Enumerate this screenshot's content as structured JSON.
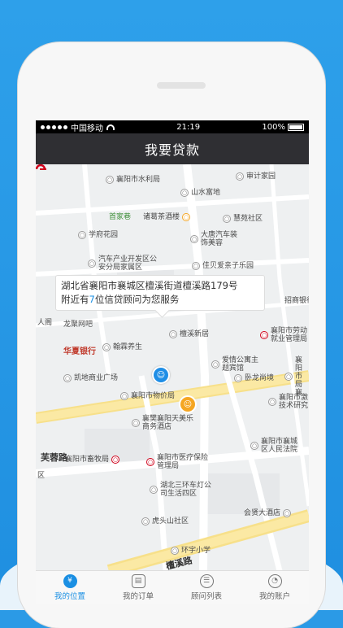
{
  "status_bar": {
    "carrier": "中国移动",
    "time": "21:19",
    "battery": "100%"
  },
  "header": {
    "title": "我要贷款"
  },
  "map": {
    "callout": {
      "line1": "湖北省襄阳市襄城区檀溪街道檀溪路179号",
      "line2_prefix": "附近有",
      "advisor_count": "7",
      "line2_suffix": "位信贷顾问为您服务"
    },
    "pois": [
      "襄阳市水利局",
      "审计家园",
      "山水富地",
      "首家巷",
      "诸葛茶酒楼",
      "慧苑社区",
      "学府花园",
      "大唐汽车装饰美容",
      "汽车产业开发区公安分局家属区",
      "佳贝爱亲子乐园",
      "招商银行",
      "人阁",
      "龙聚网吧",
      "檀溪新居",
      "襄阳市劳动就业管理局",
      "华夏银行",
      "翰霖养生",
      "爱情公寓主题宾馆",
      "襄阳市局襄",
      "凯地商业广场",
      "卧龙尚境",
      "襄阳市物价局",
      "襄阳市激技术研究",
      "襄樊襄阳天美乐商务酒店",
      "襄阳市襄城区人民法院",
      "芙蓉路",
      "区",
      "襄阳市畜牧局",
      "襄阳市医疗保险管理局",
      "湖北三环车灯公司生活四区",
      "会贤大酒店",
      "虎头山社区",
      "环宇小学",
      "檀溪路"
    ]
  },
  "tabbar": {
    "tabs": [
      {
        "label": "我的位置",
        "icon": "yen-icon",
        "glyph": "¥"
      },
      {
        "label": "我的订单",
        "icon": "order-icon",
        "glyph": "▤"
      },
      {
        "label": "顾问列表",
        "icon": "list-icon",
        "glyph": "☰"
      },
      {
        "label": "我的账户",
        "icon": "user-icon",
        "glyph": "◔"
      }
    ]
  }
}
